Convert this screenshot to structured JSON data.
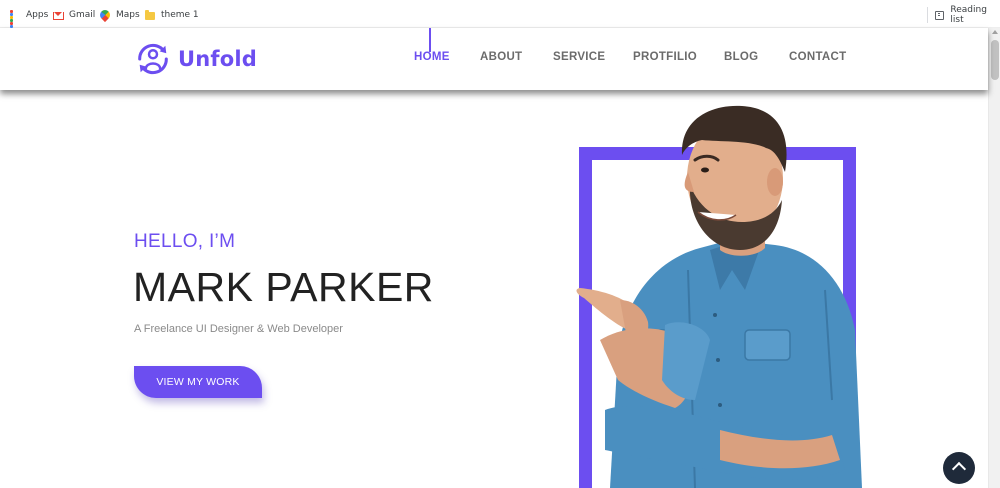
{
  "browser": {
    "bookmarks": [
      {
        "label": "Apps",
        "icon": "apps-grid-icon"
      },
      {
        "label": "Gmail",
        "icon": "gmail-icon"
      },
      {
        "label": "Maps",
        "icon": "maps-icon"
      },
      {
        "label": "theme 1",
        "icon": "folder-icon"
      }
    ],
    "reading_list": {
      "label": "Reading list",
      "icon": "reading-list-icon"
    }
  },
  "header": {
    "logo_text": "Unfold",
    "logo_icon": "user-circle-arrows-icon",
    "nav": [
      {
        "label": "HOME",
        "active": true
      },
      {
        "label": "ABOUT",
        "active": false
      },
      {
        "label": "SERVICE",
        "active": false
      },
      {
        "label": "PROTFILIO",
        "active": false
      },
      {
        "label": "BLOG",
        "active": false
      },
      {
        "label": "CONTACT",
        "active": false
      }
    ]
  },
  "hero": {
    "greeting": "HELLO, I’M",
    "name": "MARK PARKER",
    "tagline": "A Freelance UI Designer & Web Developer",
    "cta_label": "VIEW MY WORK",
    "portrait_icon": "man-pointing-portrait"
  },
  "back_to_top_icon": "chevron-up-icon",
  "colors": {
    "accent": "#6c4ef0",
    "heading": "#222222",
    "muted": "#8a8a8a",
    "nav": "#6b6b6b",
    "back_to_top_bg": "#1f2a3a"
  }
}
